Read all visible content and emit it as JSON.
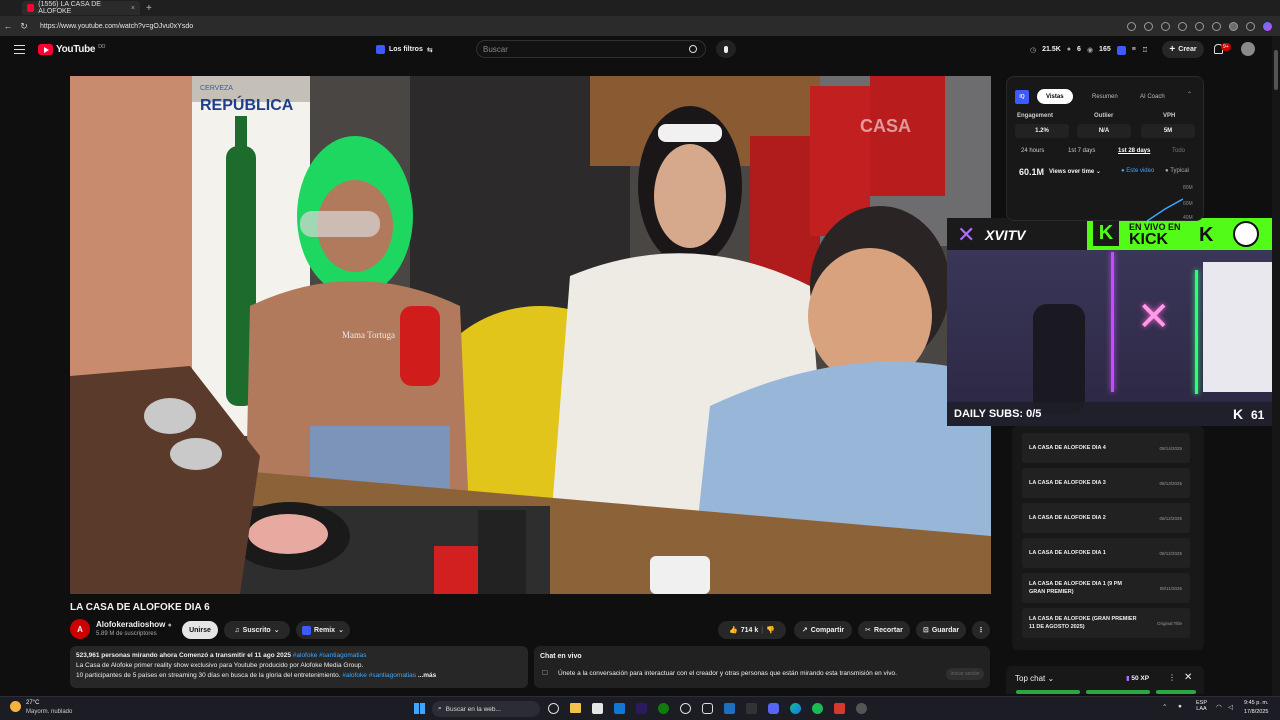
{
  "browser": {
    "tab_title": "(1556) LA CASA DE ALOFOKE",
    "tab_close": "×",
    "new_tab": "+",
    "url": "https://www.youtube.com/watch?v=gOJvu0xYsdo"
  },
  "header": {
    "logo": "YouTube",
    "region": "DO",
    "filters_label": "Los filtros",
    "search_placeholder": "Buscar",
    "stats": [
      "21.5K",
      "6",
      "165"
    ],
    "create_label": "Crear",
    "notifications": "9+"
  },
  "video": {
    "title": "LA CASA DE ALOFOKE DIA 6",
    "bottle_brand": "REPÚBLICA",
    "bottle_small": "CERVEZA",
    "watermark": "CASA",
    "necklace_text": "Mama Tortuga"
  },
  "channel": {
    "name": "Alofokeradioshow",
    "subs": "5.89 M de suscriptores",
    "join_label": "Unirse",
    "subscribed_label": "Suscrito",
    "remix_label": "Remix"
  },
  "actions": {
    "likes": "714 k",
    "share": "Compartir",
    "clip": "Recortar",
    "save": "Guardar",
    "more": "⋮"
  },
  "description": {
    "line1": "523,961 personas mirando ahora  Comenzó a transmitir el 11 ago 2025",
    "line1_tags": "#alofoke #santiagomatias",
    "line2": "La Casa de Alofoke primer reality show exclusivo para Youtube producido por Alofoke Media Group.",
    "line3": "10 participantes de 5 países en streaming 30 días en busca de la gloria del entretenimiento.",
    "line3_tags": "#alofoke #santiagomatias",
    "more": "...más"
  },
  "chat": {
    "title": "Chat en vivo",
    "text": "Únete a la conversación para interactuar con el creador y otras personas que están mirando esta transmisión en vivo.",
    "button": "Iniciar sesión"
  },
  "vidiq": {
    "badge": "IQ",
    "tabs": [
      "Vistas",
      "Resumen",
      "AI Coach"
    ],
    "metrics": [
      {
        "label": "Engagement",
        "value": "1.2%"
      },
      {
        "label": "Outlier",
        "value": "N/A"
      },
      {
        "label": "VPH",
        "value": "5M"
      }
    ],
    "ranges": [
      "24 hours",
      "1st 7 days",
      "1st 28 days",
      "Todo"
    ],
    "total_views": "60.1M",
    "views_over_time": "Views over time",
    "legend_this": "Este video",
    "legend_typical": "Typical",
    "axis": [
      "80M",
      "60M",
      "40M"
    ]
  },
  "overlay": {
    "brand": "XVITV",
    "live_text": "EN VIVO EN",
    "kick": "KICK",
    "daily_subs": "DAILY SUBS: 0/5",
    "viewer_count": "61"
  },
  "playlist": [
    {
      "title": "LA CASA DE ALOFOKE DIA 4",
      "date": "08/14/2025"
    },
    {
      "title": "LA CASA DE ALOFOKE DIA 3",
      "date": "08/13/2025"
    },
    {
      "title": "LA CASA DE ALOFOKE DIA 2",
      "date": "08/12/2025"
    },
    {
      "title": "LA CASA DE ALOFOKE DIA 1",
      "date": "08/12/2025"
    },
    {
      "title": "LA CASA DE ALOFOKE DIA 1 (9 PM GRAN PREMIER)",
      "date": "08/11/2025"
    },
    {
      "title": "LA CASA DE ALOFOKE (GRAN PREMIER 11 DE AGOSTO 2025)",
      "date": "Original Title"
    }
  ],
  "topchat": {
    "label": "Top chat",
    "xp": "50 XP"
  },
  "taskbar": {
    "weather_temp": "27°C",
    "weather_desc": "Mayorm. nublado",
    "search_placeholder": "Buscar en la web...",
    "lang": "ESP",
    "lang2": "LAA",
    "time": "9:45 p. m.",
    "date": "17/8/2025"
  }
}
